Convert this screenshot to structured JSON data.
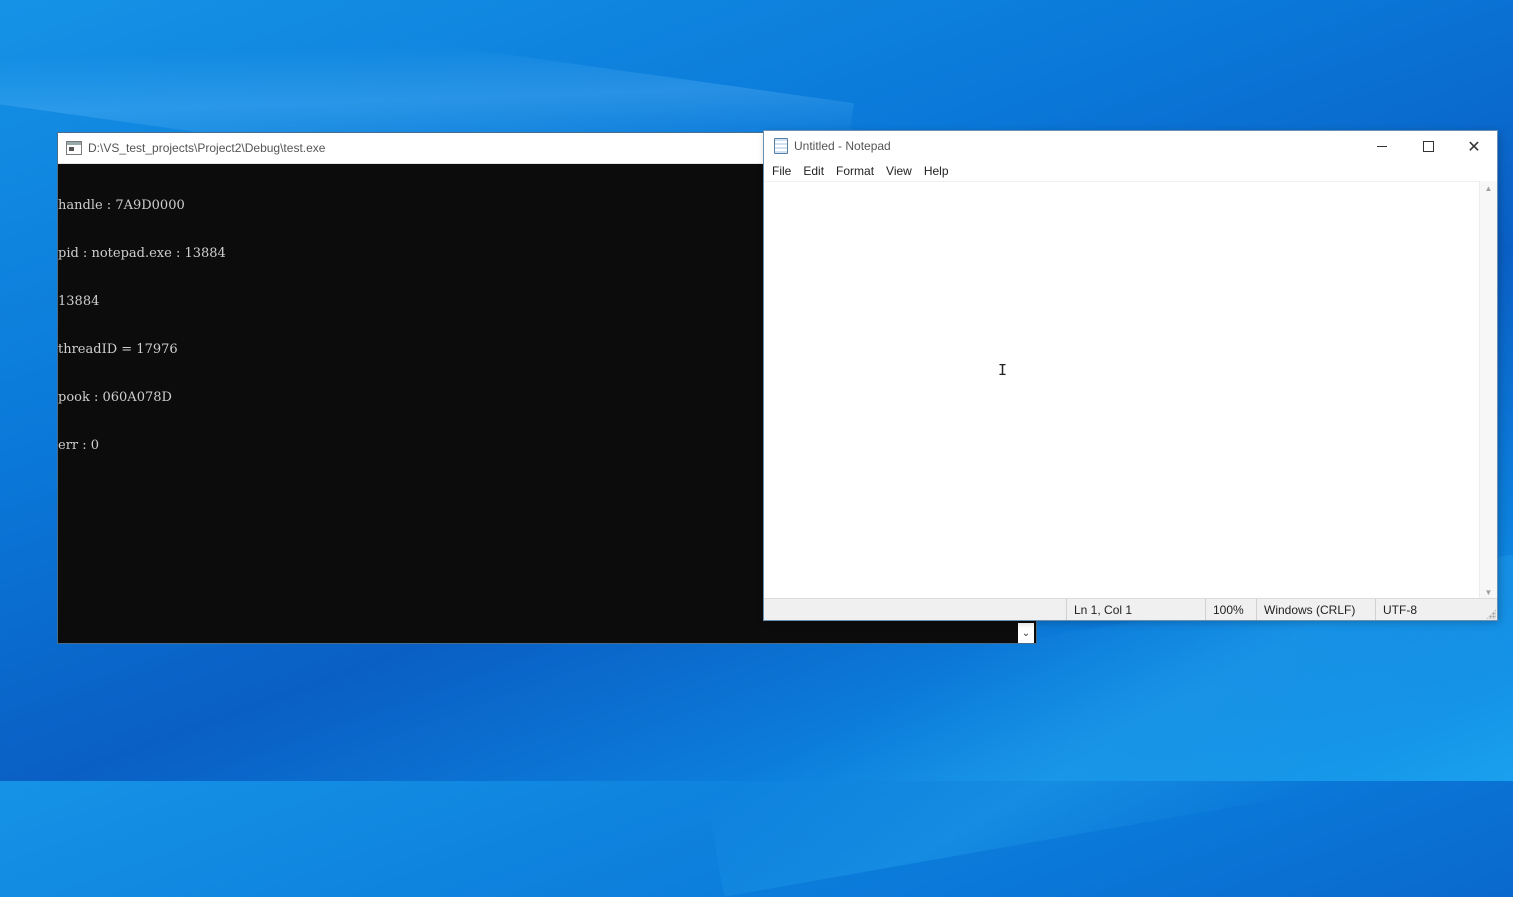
{
  "console": {
    "title": "D:\\VS_test_projects\\Project2\\Debug\\test.exe",
    "lines": [
      "handle : 7A9D0000",
      "pid : notepad.exe : 13884",
      "13884",
      "threadID = 17976",
      "pook : 060A078D",
      "err : 0"
    ]
  },
  "notepad": {
    "title": "Untitled - Notepad",
    "menu": [
      "File",
      "Edit",
      "Format",
      "View",
      "Help"
    ],
    "text": "",
    "status": {
      "position": "Ln 1, Col 1",
      "zoom": "100%",
      "line_ending": "Windows (CRLF)",
      "encoding": "UTF-8"
    }
  },
  "icons": {
    "console_app": "console-icon",
    "notepad_app": "notepad-icon",
    "minimize": "minimize-icon",
    "maximize": "maximize-icon",
    "close": "close-icon",
    "text_cursor": "i-beam-cursor-icon"
  }
}
